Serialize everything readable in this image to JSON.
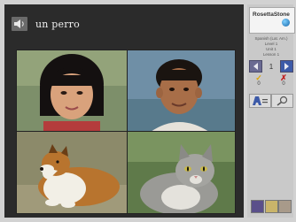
{
  "prompt": {
    "text": "un perro",
    "icon": "speaker-icon"
  },
  "pictures": [
    {
      "subject": "girl",
      "selectable": true
    },
    {
      "subject": "boy",
      "selectable": true
    },
    {
      "subject": "dog",
      "selectable": true
    },
    {
      "subject": "cat",
      "selectable": true
    }
  ],
  "sidebar": {
    "logo_text": "RosettaStone",
    "info_lines": [
      "Spanish (Lat. Am.)",
      "Level 1",
      "Unit 1",
      "Lesson 1"
    ],
    "nav": {
      "current": "1",
      "prev_icon": "chevron-left-icon",
      "next_icon": "chevron-right-icon"
    },
    "score": {
      "correct": "0",
      "incorrect": "0"
    },
    "tools": [
      "text-options-icon",
      "hint-icon"
    ],
    "bottom_tools": [
      "book-icon",
      "notes-icon",
      "exit-icon"
    ]
  },
  "colors": {
    "panel": "#2b2b2b",
    "sidebar": "#c9c9c9",
    "accent_blue": "#3d5aa8",
    "correct": "#e0a400",
    "incorrect": "#c02020"
  }
}
